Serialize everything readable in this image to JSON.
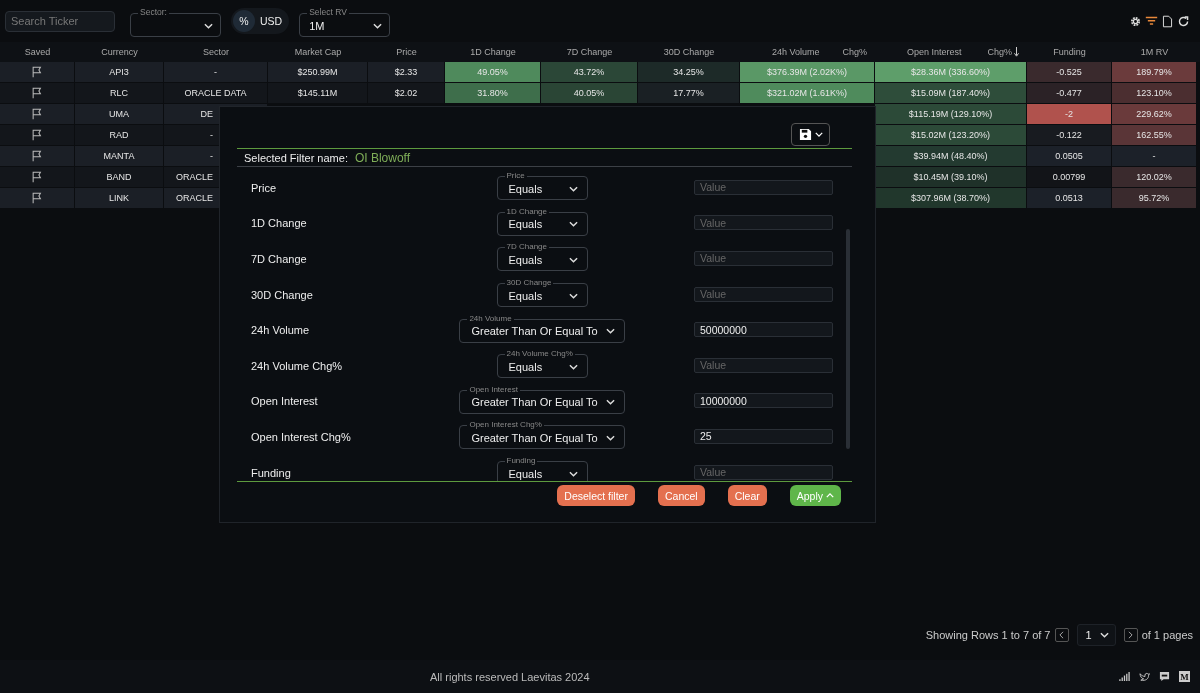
{
  "toolbar": {
    "search": {
      "placeholder": "Search Ticker"
    },
    "sector": {
      "label": "Sector:"
    },
    "units": [
      {
        "label": "%",
        "selected": true
      },
      {
        "label": "USD",
        "selected": false
      }
    ],
    "rv": {
      "label": "Select RV",
      "value": "1M"
    },
    "actions": [
      {
        "kind": "settings",
        "active": false
      },
      {
        "kind": "filter",
        "active": true
      },
      {
        "kind": "export",
        "active": false
      },
      {
        "kind": "refresh",
        "active": false
      }
    ]
  },
  "table": {
    "columns": [
      {
        "label": "Saved"
      },
      {
        "label": "Currency"
      },
      {
        "label": "Sector"
      },
      {
        "label": "Market Cap"
      },
      {
        "label": "Price"
      },
      {
        "label": "1D Change"
      },
      {
        "label": "7D Change"
      },
      {
        "label": "30D Change"
      },
      {
        "label": "24h Volume",
        "sub": "Chg%"
      },
      {
        "label": "Open Interest",
        "sub": "Chg%",
        "sorted": true
      },
      {
        "label": "Funding"
      },
      {
        "label": "1M RV"
      }
    ],
    "rows": [
      {
        "cells": [
          {
            "kind": "flag"
          },
          {
            "text": "API3"
          },
          {
            "text": "-"
          },
          {
            "text": "$250.99M"
          },
          {
            "text": "$2.33"
          },
          {
            "text": "49.05%",
            "color": "#4f8a5c"
          },
          {
            "text": "43.72%",
            "color": "#2b4737"
          },
          {
            "text": "34.25%",
            "color": "#1d2a28"
          },
          {
            "text": "$376.39M (2.02K%)",
            "color": "#5a9866"
          },
          {
            "text": "$28.36M (336.60%)",
            "color": "#5e9e6a"
          },
          {
            "text": "-0.525",
            "color": "#3a2a2d"
          },
          {
            "text": "189.79%",
            "color": "#6b3b3c"
          }
        ]
      },
      {
        "cells": [
          {
            "kind": "flag"
          },
          {
            "text": "RLC"
          },
          {
            "text": "ORACLE DATA"
          },
          {
            "text": "$145.11M"
          },
          {
            "text": "$2.02"
          },
          {
            "text": "31.80%",
            "color": "#3e6e4b"
          },
          {
            "text": "40.05%",
            "color": "#2a4535"
          },
          {
            "text": "17.77%",
            "color": "#1a2024"
          },
          {
            "text": "$321.02M (1.61K%)",
            "color": "#4f8b5c"
          },
          {
            "text": "$15.09M (187.40%)",
            "color": "#2e4d3a"
          },
          {
            "text": "-0.477",
            "color": "#2b2226"
          },
          {
            "text": "123.10%",
            "color": "#4b2e30"
          }
        ]
      },
      {
        "cells": [
          {
            "kind": "flag"
          },
          {
            "text": "UMA"
          },
          {
            "text": "DE"
          },
          null,
          null,
          null,
          null,
          null,
          null,
          {
            "text": "$115.19M (129.10%)",
            "color": "#2c4a38"
          },
          {
            "text": "-2",
            "color": "#b0524d"
          },
          {
            "text": "229.62%",
            "color": "#6a3a3b"
          }
        ]
      },
      {
        "cells": [
          {
            "kind": "flag"
          },
          {
            "text": "RAD"
          },
          {
            "text": "-"
          },
          null,
          null,
          null,
          null,
          null,
          null,
          {
            "text": "$15.02M (123.20%)",
            "color": "#2c4a38"
          },
          {
            "text": "-0.122",
            "color": "#181b20"
          },
          {
            "text": "162.55%",
            "color": "#5a3537"
          }
        ]
      },
      {
        "cells": [
          {
            "kind": "flag"
          },
          {
            "text": "MANTA"
          },
          {
            "text": "-"
          },
          null,
          null,
          null,
          null,
          null,
          null,
          {
            "text": "$39.94M (48.40%)",
            "color": "#233a30"
          },
          {
            "text": "0.0505",
            "color": "#1c2129"
          },
          {
            "text": "-",
            "color": "#1c2129"
          }
        ]
      },
      {
        "cells": [
          {
            "kind": "flag"
          },
          {
            "text": "BAND"
          },
          {
            "text": "ORACLE"
          },
          null,
          null,
          null,
          null,
          null,
          null,
          {
            "text": "$10.45M (39.10%)",
            "color": "#1f3129"
          },
          {
            "text": "0.00799",
            "color": "#121418"
          },
          {
            "text": "120.02%",
            "color": "#3a2a2d"
          }
        ]
      },
      {
        "cells": [
          {
            "kind": "flag"
          },
          {
            "text": "LINK"
          },
          {
            "text": "ORACLE"
          },
          null,
          null,
          null,
          null,
          null,
          null,
          {
            "text": "$307.96M (38.70%)",
            "color": "#21372c"
          },
          {
            "text": "0.0513",
            "color": "#1c2129"
          },
          {
            "text": "95.72%",
            "color": "#3a2a2d"
          }
        ]
      }
    ]
  },
  "filter_dialog": {
    "name_label": "Selected Filter name:",
    "name": "OI Blowoff",
    "filters": [
      {
        "label": "Price",
        "operator_label": "Price",
        "operator": "Equals",
        "placeholder": "Value"
      },
      {
        "label": "1D Change",
        "operator_label": "1D Change",
        "operator": "Equals",
        "placeholder": "Value"
      },
      {
        "label": "7D Change",
        "operator_label": "7D Change",
        "operator": "Equals",
        "placeholder": "Value"
      },
      {
        "label": "30D Change",
        "operator_label": "30D Change",
        "operator": "Equals",
        "placeholder": "Value"
      },
      {
        "label": "24h Volume",
        "operator_label": "24h Volume",
        "operator": "Greater Than Or Equal To",
        "value": "50000000"
      },
      {
        "label": "24h Volume Chg%",
        "operator_label": "24h Volume Chg%",
        "operator": "Equals",
        "placeholder": "Value"
      },
      {
        "label": "Open Interest",
        "operator_label": "Open Interest",
        "operator": "Greater Than Or Equal To",
        "value": "10000000"
      },
      {
        "label": "Open Interest Chg%",
        "operator_label": "Open Interest Chg%",
        "operator": "Greater Than Or Equal To",
        "value": "25"
      },
      {
        "label": "Funding",
        "operator_label": "Funding",
        "operator": "Equals",
        "placeholder": "Value"
      }
    ],
    "buttons": [
      {
        "label": "Deselect filter",
        "kind": "danger"
      },
      {
        "label": "Cancel",
        "kind": "danger"
      },
      {
        "label": "Clear",
        "kind": "danger"
      },
      {
        "label": "Apply",
        "kind": "primary"
      }
    ]
  },
  "pagination": {
    "summary": "Showing Rows 1 to 7 of 7",
    "page": "1",
    "total": "of 1 pages"
  },
  "footer": {
    "copyright": "All rights reserved Laevitas 2024",
    "links": [
      {
        "kind": "signal"
      },
      {
        "kind": "bird"
      },
      {
        "kind": "chat"
      },
      {
        "kind": "badge",
        "text": "M"
      }
    ]
  }
}
